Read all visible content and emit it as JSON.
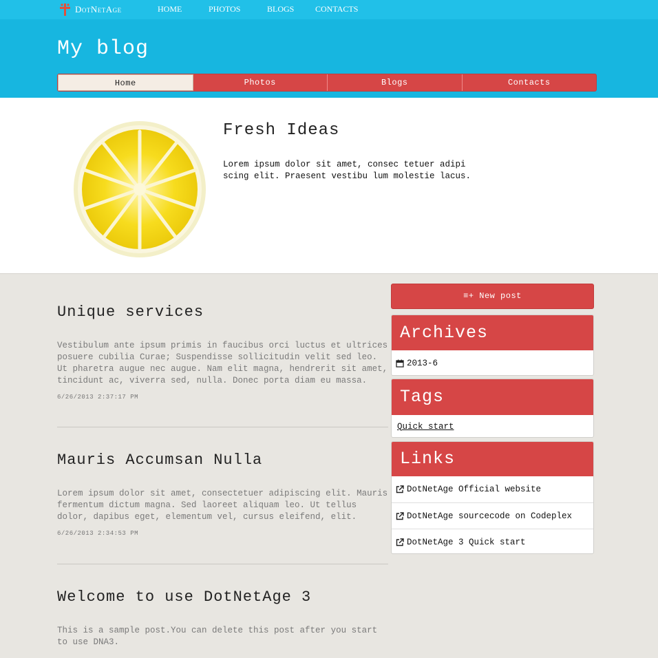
{
  "topbar": {
    "logo_text": "DotNetAge",
    "nav": [
      "HOME",
      "PHOTOS",
      "BLOGS",
      "CONTACTS"
    ]
  },
  "header": {
    "title": "My blog",
    "tabs": [
      {
        "label": "Home",
        "active": true
      },
      {
        "label": "Photos",
        "active": false
      },
      {
        "label": "Blogs",
        "active": false
      },
      {
        "label": "Contacts",
        "active": false
      }
    ]
  },
  "hero": {
    "title": "Fresh Ideas",
    "text": "Lorem ipsum dolor sit amet, consec tetuer adipi scing elit. Praesent vestibu lum molestie lacus.",
    "image_icon": "lemon-slice-image"
  },
  "posts": [
    {
      "title": "Unique services",
      "body": "Vestibulum ante ipsum primis in faucibus orci luctus et ultrices posuere cubilia Curae; Suspendisse sollicitudin velit sed leo. Ut pharetra augue nec augue. Nam elit magna, hendrerit sit amet, tincidunt ac, viverra sed, nulla. Donec porta diam eu massa.",
      "date": "6/26/2013 2:37:17 PM"
    },
    {
      "title": "Mauris Accumsan Nulla",
      "body": "Lorem ipsum dolor sit amet, consectetuer adipiscing elit. Mauris fermentum dictum magna. Sed laoreet aliquam leo. Ut tellus dolor, dapibus eget, elementum vel, cursus eleifend, elit.",
      "date": "6/26/2013 2:34:53 PM"
    },
    {
      "title": "Welcome to use DotNetAge 3",
      "body": "This is a sample post.You can delete this post after you start to use DNA3."
    }
  ],
  "sidebar": {
    "new_post_label": "≡+ New post",
    "archives": {
      "title": "Archives",
      "items": [
        "2013-6"
      ]
    },
    "tags": {
      "title": "Tags",
      "items": [
        "Quick start"
      ]
    },
    "links": {
      "title": "Links",
      "items": [
        "DotNetAge Official website",
        "DotNetAge sourcecode on Codeplex",
        "DotNetAge 3 Quick start"
      ]
    }
  },
  "colors": {
    "topbar": "#21c0e8",
    "header": "#17b6e0",
    "accent_red": "#d64646",
    "page_bg": "#e8e6e1"
  }
}
